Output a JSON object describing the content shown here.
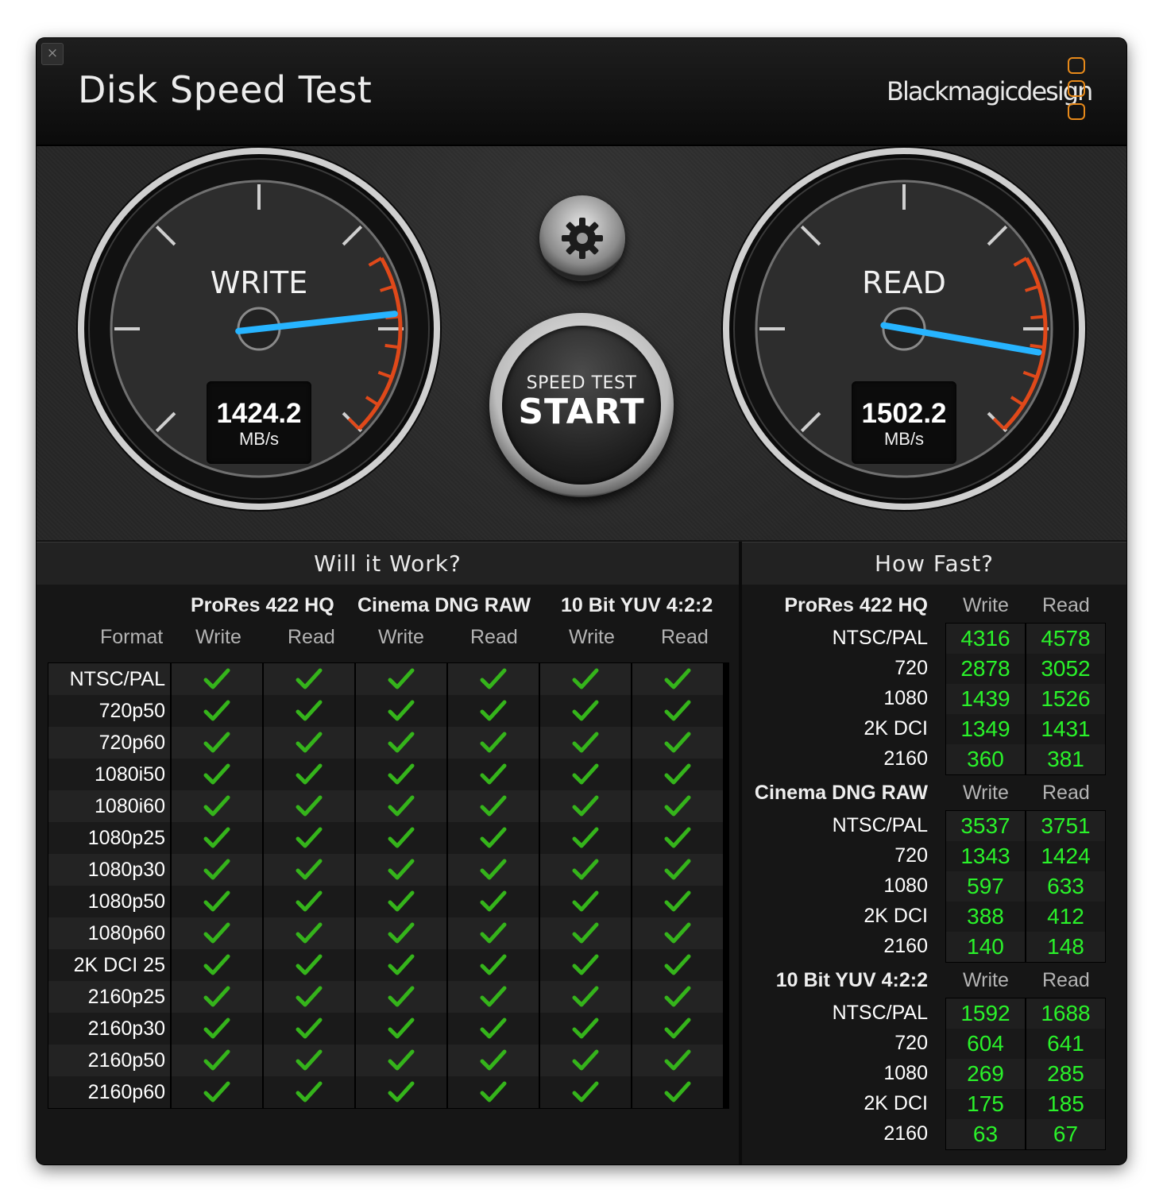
{
  "window": {
    "title": "Disk Speed Test",
    "brand": "Blackmagicdesign",
    "close_glyph": "×"
  },
  "colors": {
    "accent_needle": "#27b4ff",
    "redline": "#e0491a",
    "pass_check": "#35b41b",
    "speed_text": "#2af22a",
    "logo": "#e88a1a"
  },
  "write_meter": {
    "label": "WRITE",
    "value": "1424.2",
    "unit": "MB/s",
    "needle_fraction": 0.81
  },
  "read_meter": {
    "label": "READ",
    "value": "1502.2",
    "unit": "MB/s",
    "needle_fraction": 0.87
  },
  "settings": {
    "icon": "gear-icon"
  },
  "start_button": {
    "small": "SPEED TEST",
    "big": "START"
  },
  "will_it_work": {
    "title": "Will it Work?",
    "codecs": [
      "ProRes 422 HQ",
      "Cinema DNG RAW",
      "10 Bit YUV 4:2:2"
    ],
    "format_label": "Format",
    "columns": [
      "Write",
      "Read",
      "Write",
      "Read",
      "Write",
      "Read"
    ],
    "check_icon": "checkmark-icon",
    "rows": [
      {
        "format": "NTSC/PAL",
        "pass": [
          true,
          true,
          true,
          true,
          true,
          true
        ]
      },
      {
        "format": "720p50",
        "pass": [
          true,
          true,
          true,
          true,
          true,
          true
        ]
      },
      {
        "format": "720p60",
        "pass": [
          true,
          true,
          true,
          true,
          true,
          true
        ]
      },
      {
        "format": "1080i50",
        "pass": [
          true,
          true,
          true,
          true,
          true,
          true
        ]
      },
      {
        "format": "1080i60",
        "pass": [
          true,
          true,
          true,
          true,
          true,
          true
        ]
      },
      {
        "format": "1080p25",
        "pass": [
          true,
          true,
          true,
          true,
          true,
          true
        ]
      },
      {
        "format": "1080p30",
        "pass": [
          true,
          true,
          true,
          true,
          true,
          true
        ]
      },
      {
        "format": "1080p50",
        "pass": [
          true,
          true,
          true,
          true,
          true,
          true
        ]
      },
      {
        "format": "1080p60",
        "pass": [
          true,
          true,
          true,
          true,
          true,
          true
        ]
      },
      {
        "format": "2K DCI 25",
        "pass": [
          true,
          true,
          true,
          true,
          true,
          true
        ]
      },
      {
        "format": "2160p25",
        "pass": [
          true,
          true,
          true,
          true,
          true,
          true
        ]
      },
      {
        "format": "2160p30",
        "pass": [
          true,
          true,
          true,
          true,
          true,
          true
        ]
      },
      {
        "format": "2160p50",
        "pass": [
          true,
          true,
          true,
          true,
          true,
          true
        ]
      },
      {
        "format": "2160p60",
        "pass": [
          true,
          true,
          true,
          true,
          true,
          true
        ]
      }
    ]
  },
  "how_fast": {
    "title": "How Fast?",
    "write_label": "Write",
    "read_label": "Read",
    "groups": [
      {
        "codec": "ProRes 422 HQ",
        "rows": [
          {
            "format": "NTSC/PAL",
            "write": "4316",
            "read": "4578"
          },
          {
            "format": "720",
            "write": "2878",
            "read": "3052"
          },
          {
            "format": "1080",
            "write": "1439",
            "read": "1526"
          },
          {
            "format": "2K DCI",
            "write": "1349",
            "read": "1431"
          },
          {
            "format": "2160",
            "write": "360",
            "read": "381"
          }
        ]
      },
      {
        "codec": "Cinema DNG RAW",
        "rows": [
          {
            "format": "NTSC/PAL",
            "write": "3537",
            "read": "3751"
          },
          {
            "format": "720",
            "write": "1343",
            "read": "1424"
          },
          {
            "format": "1080",
            "write": "597",
            "read": "633"
          },
          {
            "format": "2K DCI",
            "write": "388",
            "read": "412"
          },
          {
            "format": "2160",
            "write": "140",
            "read": "148"
          }
        ]
      },
      {
        "codec": "10 Bit YUV 4:2:2",
        "rows": [
          {
            "format": "NTSC/PAL",
            "write": "1592",
            "read": "1688"
          },
          {
            "format": "720",
            "write": "604",
            "read": "641"
          },
          {
            "format": "1080",
            "write": "269",
            "read": "285"
          },
          {
            "format": "2K DCI",
            "write": "175",
            "read": "185"
          },
          {
            "format": "2160",
            "write": "63",
            "read": "67"
          }
        ]
      }
    ]
  }
}
